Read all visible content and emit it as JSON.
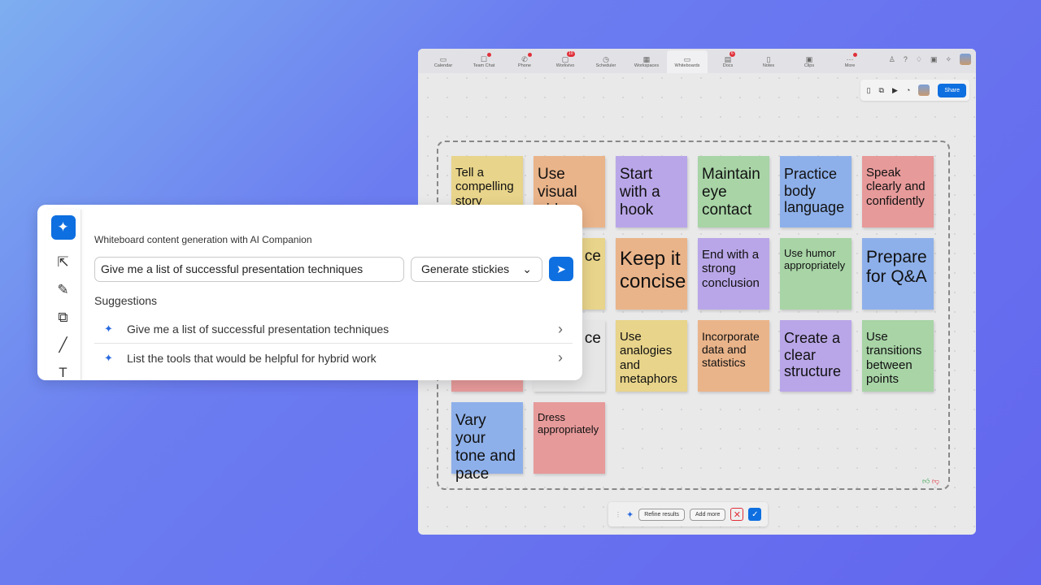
{
  "nav": {
    "tabs": [
      {
        "label": "Calendar",
        "icon": "calendar-icon",
        "glyph": "▭"
      },
      {
        "label": "Team Chat",
        "icon": "chat-icon",
        "glyph": "☐",
        "dot": true
      },
      {
        "label": "Phone",
        "icon": "phone-icon",
        "glyph": "✆",
        "dot": true
      },
      {
        "label": "Workvivo",
        "icon": "workvivo-icon",
        "glyph": "▢",
        "badge": "10"
      },
      {
        "label": "Scheduler",
        "icon": "clock-icon",
        "glyph": "◷"
      },
      {
        "label": "Workspaces",
        "icon": "workspaces-icon",
        "glyph": "▦"
      },
      {
        "label": "Whiteboards",
        "icon": "whiteboard-icon",
        "glyph": "▭",
        "active": true
      },
      {
        "label": "Docs",
        "icon": "docs-icon",
        "glyph": "▤",
        "badge": "6"
      },
      {
        "label": "Notes",
        "icon": "notes-icon",
        "glyph": "▯"
      },
      {
        "label": "Clips",
        "icon": "clips-icon",
        "glyph": "▣"
      },
      {
        "label": "More",
        "icon": "more-icon",
        "glyph": "···",
        "dot": true
      }
    ]
  },
  "toolbar": {
    "share": "Share"
  },
  "stickies": [
    {
      "text": "Tell a compelling story",
      "color": "y",
      "size": 15
    },
    {
      "text": "Use visual aids",
      "color": "o",
      "size": 19
    },
    {
      "text": "Start with a hook",
      "color": "p",
      "size": 19
    },
    {
      "text": "Maintain eye contact",
      "color": "g",
      "size": 19
    },
    {
      "text": "Practice body language",
      "color": "b",
      "size": 18
    },
    {
      "text": "Speak clearly and confidently",
      "color": "r",
      "size": 15
    },
    {
      "text": "",
      "color": "r",
      "size": 15
    },
    {
      "text": "t ce",
      "color": "y",
      "size": 19
    },
    {
      "text": "Keep it concise",
      "color": "o",
      "size": 24
    },
    {
      "text": "End with a strong conclusion",
      "color": "p",
      "size": 15
    },
    {
      "text": "Use humor appropriately",
      "color": "g",
      "size": 13
    },
    {
      "text": "Prepare for Q&A",
      "color": "b",
      "size": 21
    },
    {
      "text": "",
      "color": "r",
      "size": 15
    },
    {
      "text": "ce",
      "color": "w",
      "size": 19
    },
    {
      "text": "Use analogies and metaphors",
      "color": "y",
      "size": 15
    },
    {
      "text": "Incorporate data and statistics",
      "color": "o",
      "size": 14
    },
    {
      "text": "Create a clear structure",
      "color": "p",
      "size": 18
    },
    {
      "text": "Use transitions between points",
      "color": "g",
      "size": 15
    },
    {
      "text": "Vary your tone and pace",
      "color": "b",
      "size": 19
    },
    {
      "text": "Dress appropriately",
      "color": "r",
      "size": 13
    }
  ],
  "bottom": {
    "refine": "Refine results",
    "add": "Add more"
  },
  "panel": {
    "header": "Whiteboard content generation with AI Companion",
    "prompt": "Give me a list of successful presentation techniques",
    "mode": "Generate stickies",
    "suggestions_label": "Suggestions",
    "suggestions": [
      "Give me a list of successful presentation techniques",
      "List the tools that would be helpful for hybrid work"
    ]
  },
  "colors": {
    "accent": "#0e6fe0",
    "alert": "#e0303a"
  }
}
